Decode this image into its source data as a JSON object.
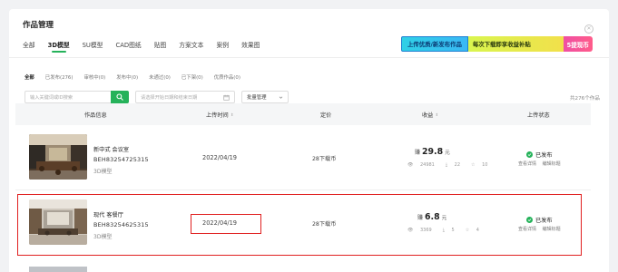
{
  "page": {
    "title": "作品管理"
  },
  "tabs": [
    "全部",
    "3D模型",
    "SU模型",
    "CAD图纸",
    "贴图",
    "方案文本",
    "案例",
    "效果图"
  ],
  "active_tab": "3D模型",
  "banner": {
    "part1": "上传优质/新发布作品",
    "part2": "每次下载即享收益补贴",
    "part3": "5提现币"
  },
  "subtabs": [
    "全部",
    "已发布(276)",
    "审核中(0)",
    "发布中(0)",
    "未通过(0)",
    "已下架(0)",
    "优质作品(0)"
  ],
  "filters": {
    "search_placeholder": "输入关键词或ID搜索",
    "date_placeholder": "请选择开始日期和结束日期",
    "batch_label": "批量管理"
  },
  "total_text": "共276个作品",
  "table": {
    "headers": {
      "info": "作品信息",
      "upload_time": "上传时间",
      "price": "定价",
      "earnings": "收益",
      "status": "上传状态"
    },
    "rows": [
      {
        "name": "新中式 会议室",
        "code": "BEH83254725315",
        "type": "3D模型",
        "date": "2022/04/19",
        "price": "28下载币",
        "earn_prefix": "赚",
        "earn_amount": "29.8",
        "earn_unit": "元",
        "views": "24981",
        "downloads": "22",
        "favorites": "10",
        "status": "已发布",
        "link_detail": "查看详情",
        "link_edit": "编辑标题"
      },
      {
        "name": "现代 客餐厅",
        "code": "BEH83254625315",
        "type": "3D模型",
        "date": "2022/04/19",
        "price": "28下载币",
        "earn_prefix": "赚",
        "earn_amount": "6.8",
        "earn_unit": "元",
        "views": "3369",
        "downloads": "5",
        "favorites": "4",
        "status": "已发布",
        "link_detail": "查看详情",
        "link_edit": "编辑标题"
      }
    ]
  },
  "colors": {
    "accent": "#25b25a",
    "highlight": "#e02020"
  }
}
